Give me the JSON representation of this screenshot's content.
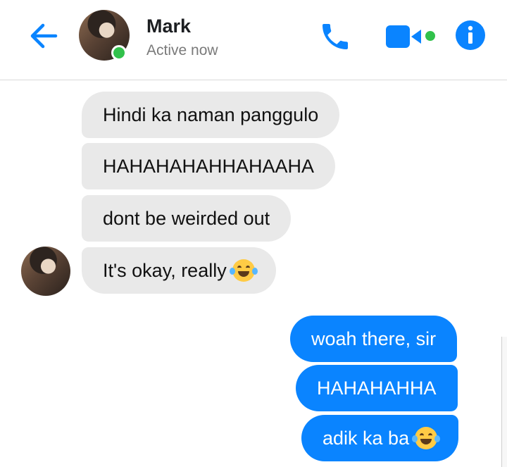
{
  "header": {
    "contact_name": "Mark",
    "status": "Active now",
    "accent_color": "#0a84ff",
    "online_color": "#31c14b",
    "icons": [
      "arrow-left-icon",
      "phone-icon",
      "video-camera-icon",
      "info-icon"
    ]
  },
  "messages": {
    "incoming": [
      {
        "text": "Hindi ka naman panggulo"
      },
      {
        "text": "HAHAHAHAHHAHAAHA"
      },
      {
        "text": "dont be weirded out"
      },
      {
        "text": "It's okay, really",
        "emoji": "tears-of-joy-emoji"
      }
    ],
    "outgoing": [
      {
        "text": "woah there, sir"
      },
      {
        "text": "HAHAHAHHA"
      },
      {
        "text": "adik ka ba",
        "emoji": "tears-of-joy-emoji"
      }
    ]
  }
}
